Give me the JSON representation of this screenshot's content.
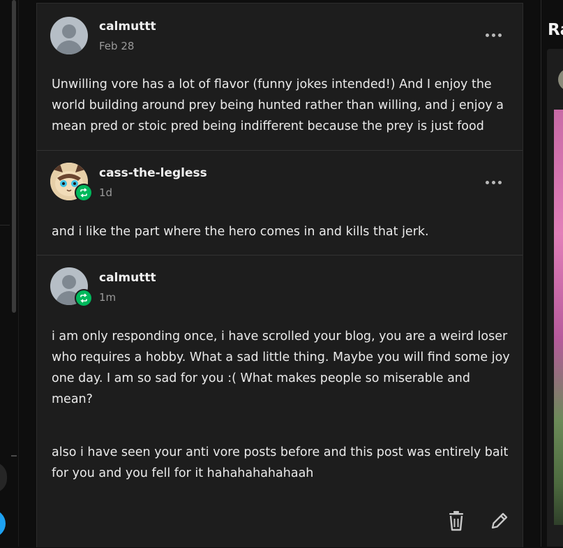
{
  "right_column": {
    "title": "Ra"
  },
  "comments": [
    {
      "username": "calmuttt",
      "timestamp": "Feb 28",
      "paragraphs": [
        "Unwilling vore has a lot of flavor (funny jokes intended!) And I enjoy the world building around prey being hunted rather than willing, and j enjoy a mean pred or stoic pred being indifferent because the prey is just food"
      ]
    },
    {
      "username": "cass-the-legless",
      "timestamp": "1d",
      "paragraphs": [
        "and i like the part where the hero comes in and kills that jerk."
      ]
    },
    {
      "username": "calmuttt",
      "timestamp": "1m",
      "paragraphs": [
        "i am only responding once, i have scrolled your blog, you are a weird loser who requires  a hobby. What a sad little thing. Maybe you will find some joy one day. I am so sad for you :( What makes people so miserable and mean?",
        "also i have seen your anti vore posts before and this post was entirely bait for you and you fell for it hahahahahahaah"
      ]
    }
  ],
  "icons": {
    "more": "more-options-icon",
    "reblog": "reblog-icon",
    "delete": "trash-icon",
    "edit": "pencil-icon"
  },
  "colors": {
    "panel_bg": "#1d1d1d",
    "page_bg": "#0e0e0e",
    "reblog_badge": "#00b85c",
    "text": "#eaeaea",
    "muted": "#9a9a9a"
  }
}
